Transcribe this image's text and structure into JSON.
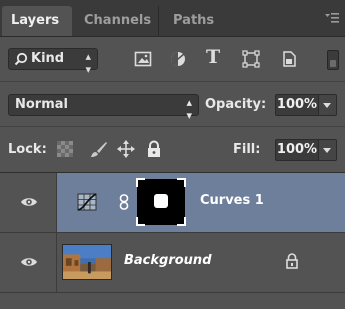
{
  "tabs": [
    {
      "label": "Layers",
      "active": true
    },
    {
      "label": "Channels",
      "active": false
    },
    {
      "label": "Paths",
      "active": false
    }
  ],
  "filter": {
    "kind_label": "Kind",
    "icons": [
      "image-filter-icon",
      "adjustment-filter-icon",
      "type-filter-icon",
      "shape-filter-icon",
      "smart-object-filter-icon"
    ]
  },
  "blend": {
    "mode": "Normal",
    "opacity_label": "Opacity:",
    "opacity_value": "100%"
  },
  "lock": {
    "label": "Lock:",
    "fill_label": "Fill:",
    "fill_value": "100%"
  },
  "layers": [
    {
      "name": "Curves 1",
      "type": "adjustment",
      "selected": true,
      "visible": true
    },
    {
      "name": "Background",
      "type": "image",
      "selected": false,
      "visible": true,
      "locked": true
    }
  ],
  "colors": {
    "panel_bg": "#535353",
    "selected_row": "#6d7f9a",
    "tabbar_bg": "#3a3a3a"
  }
}
